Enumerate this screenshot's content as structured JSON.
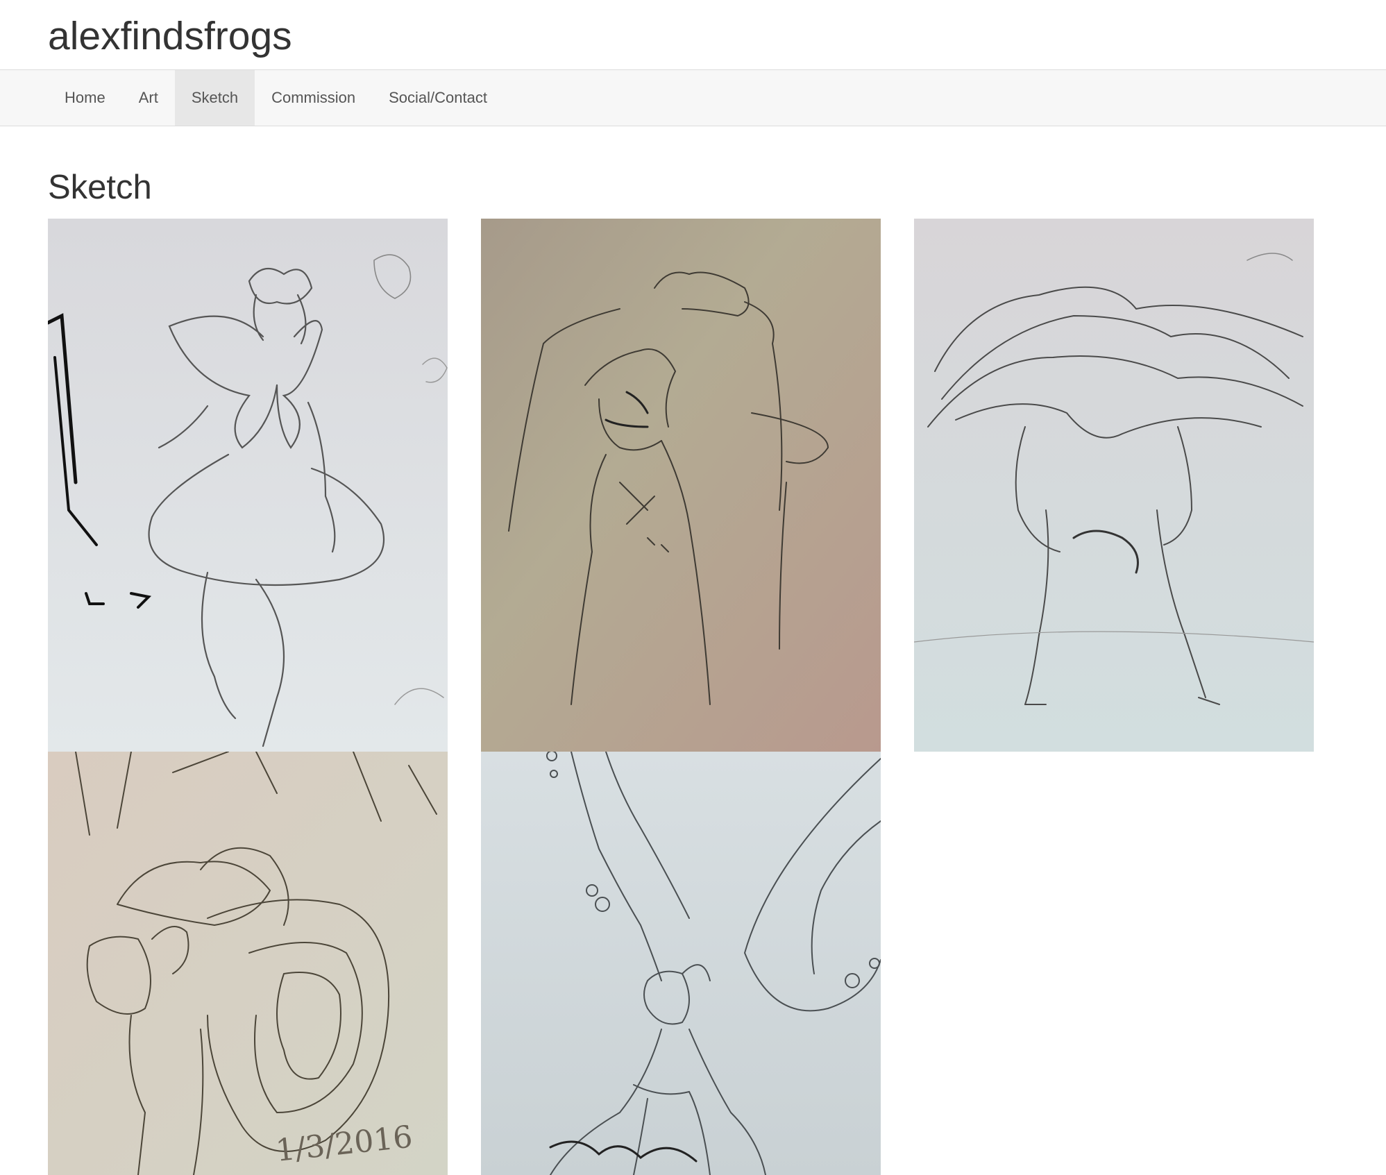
{
  "site": {
    "brand": "alexfindsfrogs"
  },
  "nav": {
    "items": [
      {
        "label": "Home",
        "active": false
      },
      {
        "label": "Art",
        "active": false
      },
      {
        "label": "Sketch",
        "active": true
      },
      {
        "label": "Commission",
        "active": false
      },
      {
        "label": "Social/Contact",
        "active": false
      }
    ]
  },
  "page": {
    "title": "Sketch"
  },
  "gallery": {
    "images": [
      {
        "subject": "fairy with flower crown from behind",
        "tone": "#dfe2e6"
      },
      {
        "subject": "figure stretching arms overhead",
        "tone": "#b3a58f"
      },
      {
        "subject": "figure with long flowing hair",
        "tone": "#d9dfe2"
      },
      {
        "subject": "figure hugging giant geode",
        "tone": "#d7cdbd",
        "date_written": "1/3/2016"
      },
      {
        "subject": "fairy with large wings",
        "tone": "#d6dde0"
      }
    ]
  },
  "colors": {
    "navbar_bg": "#f7f7f7",
    "nav_active_bg": "#e7e7e7",
    "text": "#333333",
    "nav_text": "#555555"
  }
}
